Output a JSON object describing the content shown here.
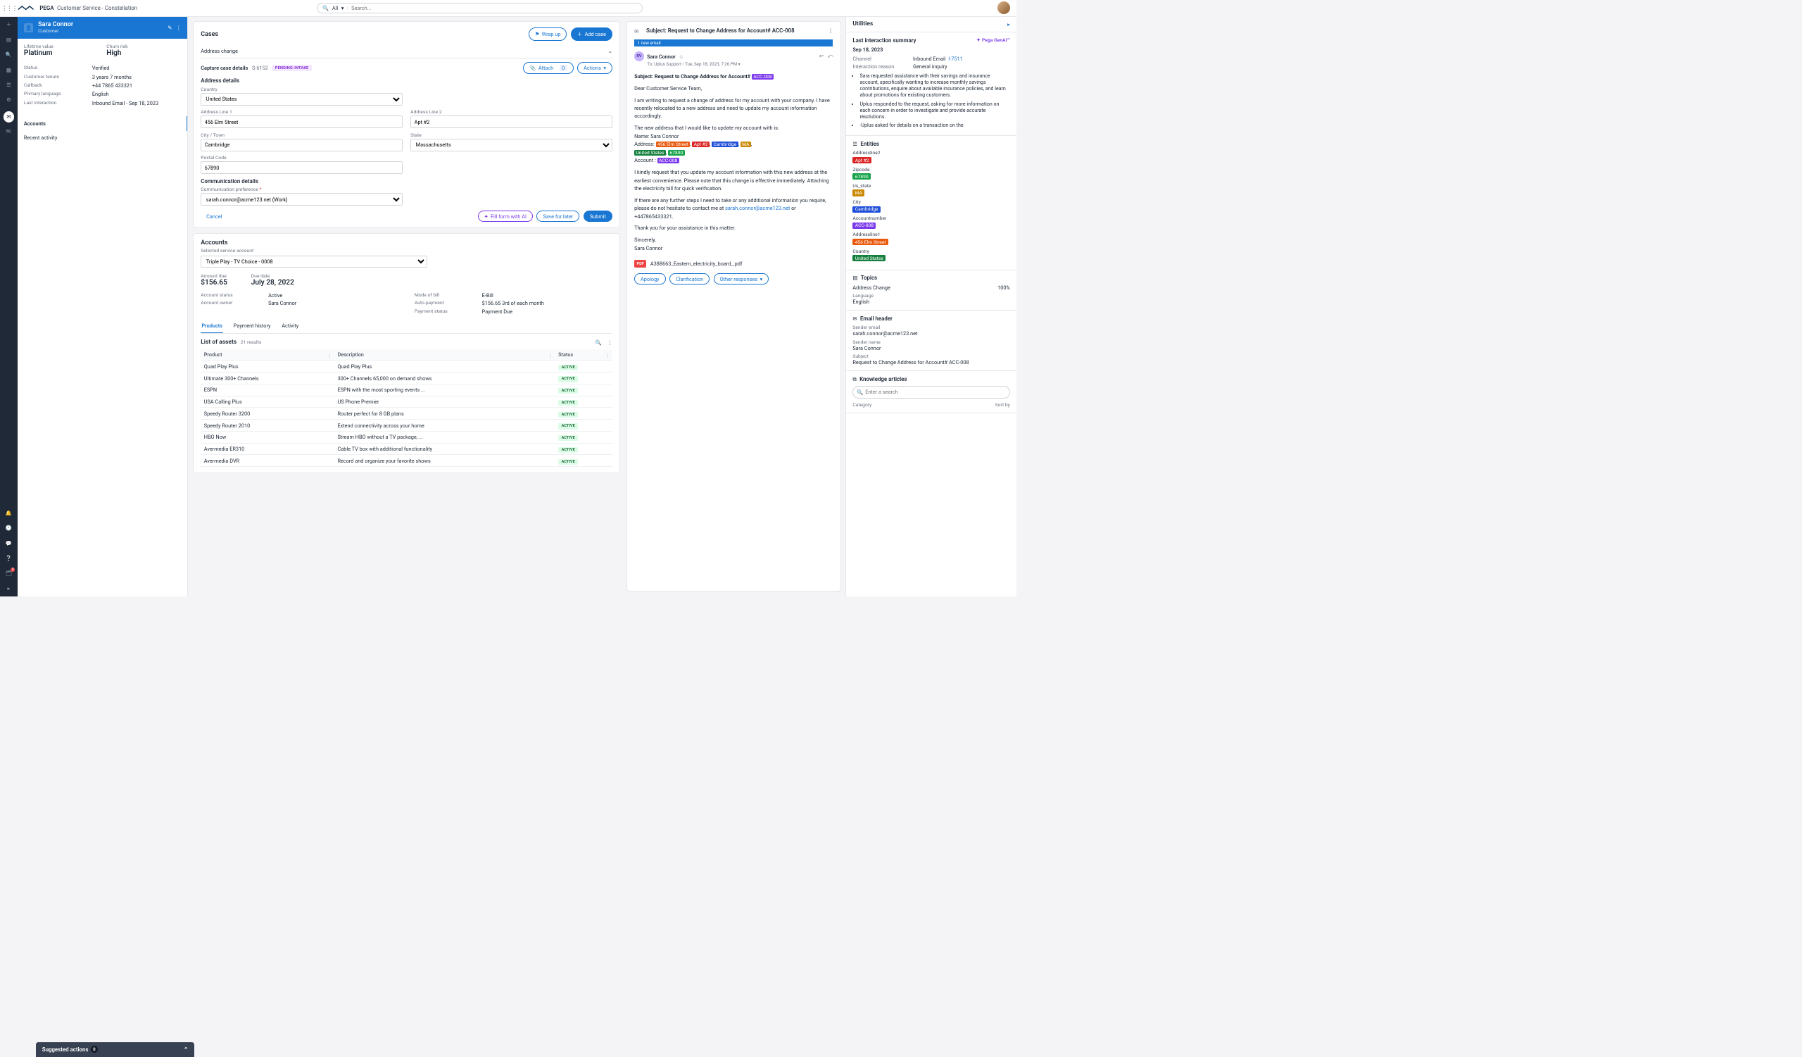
{
  "topbar": {
    "brand": "PEGA",
    "appname": "Customer Service - Constellation",
    "search_filter": "All",
    "search_placeholder": "Search..."
  },
  "customer": {
    "name": "Sara Connor",
    "role": "Customer",
    "lifetime_value_label": "Lifetime value",
    "lifetime_value": "Platinum",
    "churn_label": "Churn risk",
    "churn": "High",
    "rows": {
      "status_label": "Status",
      "status": "Verified",
      "tenure_label": "Customer tenure",
      "tenure": "3 years 7 months",
      "callback_label": "Callback",
      "callback": "+44 7865 433321",
      "lang_label": "Primary language",
      "lang": "English",
      "last_label": "Last interaction",
      "last": "Inbound Email - Sep 18, 2023"
    },
    "nav": {
      "accounts": "Accounts",
      "recent": "Recent activity"
    }
  },
  "cases": {
    "title": "Cases",
    "wrapup": "Wrap up",
    "addcase": "Add case",
    "collapse_label": "Address change",
    "capture_label": "Capture case details",
    "case_id": "S-6152",
    "status": "PENDING-INTAKE",
    "attach_label": "Attach",
    "attach_count": "0",
    "actions_label": "Actions",
    "address_h": "Address details",
    "fields": {
      "country_label": "Country",
      "country": "United States",
      "addr1_label": "Address Line 1",
      "addr1": "456 Elm Street",
      "addr2_label": "Address Line 2",
      "addr2": "Apt #2",
      "city_label": "City / Town",
      "city": "Cambridge",
      "state_label": "State",
      "state": "Massachusetts",
      "postal_label": "Postal Code",
      "postal": "67890"
    },
    "comm_h": "Communication details",
    "comm_pref_label": "Communication preference",
    "comm_pref": "sarah.connor@acme123.net (Work)",
    "cancel": "Cancel",
    "fill_ai": "Fill form with AI",
    "save_later": "Save for later",
    "submit": "Submit"
  },
  "accounts": {
    "title": "Accounts",
    "selected_label": "Selected service account",
    "selected": "Triple Play - TV Choice - 0008",
    "amount_due_label": "Amount due",
    "amount_due": "$156.65",
    "due_date_label": "Due date",
    "due_date": "July 28, 2022",
    "acct_status_label": "Account status",
    "acct_status": "Active",
    "mode_label": "Mode of bill",
    "mode": "E-Bill",
    "owner_label": "Account owner",
    "owner": "Sara Connor",
    "autopay_label": "Auto-payment",
    "autopay": "$156.65 3rd of each month",
    "paystat_label": "Payment status",
    "paystat": "Payment Due",
    "tabs": {
      "products": "Products",
      "payhist": "Payment history",
      "activity": "Activity"
    },
    "list_title": "List of assets",
    "list_count": "21 results",
    "cols": {
      "product": "Product",
      "desc": "Description",
      "status": "Status"
    },
    "rows": [
      {
        "p": "Quad Play Plus",
        "d": "Quad Play Plus",
        "s": "ACTIVE"
      },
      {
        "p": "Ultimate 300+ Channels",
        "d": "300+ Channels 65,000 on demand shows",
        "s": "ACTIVE"
      },
      {
        "p": "ESPN",
        "d": "ESPN with the most sporting events ...",
        "s": "ACTIVE"
      },
      {
        "p": "USA Calling Plus",
        "d": "US Phone Premier",
        "s": "ACTIVE"
      },
      {
        "p": "Speedy Router 3200",
        "d": "Router perfect for 8 GB plans",
        "s": "ACTIVE"
      },
      {
        "p": "Speedy Router 2010",
        "d": "Extend connectivity across your home",
        "s": "ACTIVE"
      },
      {
        "p": "HBO Now",
        "d": "Stream HBO without a TV package, ...",
        "s": "ACTIVE"
      },
      {
        "p": "Avermedia ER310",
        "d": "Cable TV box with additional functionality",
        "s": "ACTIVE"
      },
      {
        "p": "Avermedia DVR",
        "d": "Record and organize your favorite shows",
        "s": "ACTIVE"
      }
    ]
  },
  "email": {
    "subject_h": "Subject: Request to Change Address for Account# ACC-008",
    "newmail": "1 new email",
    "from_initials": "RV",
    "from_name": "Sara Connor",
    "to_line": "To: Uplus Support • Tue, Sep 18, 2023, 7:26 PM",
    "subject_inline": "Subject: Request to Change Address for Account# ",
    "acc_tag": "ACC-008",
    "greeting": "Dear Customer Service Team,",
    "p1": "I am writing to request a change of address for my account with your company. I have recently relocated to a new address and need to update my account information accordingly.",
    "p2_intro": "The new address that I would like to update my account with is:",
    "p2_name": "Name: Sara Connor",
    "p2_addr_label": "Address:",
    "addr1": "456 Elm Street",
    "addr2": "Apt #2",
    "city": "Cambridge",
    "state": "MA",
    "country": "United States",
    "zip": "67890",
    "acc_label": "Account :",
    "acc": "ACC-008",
    "p3": "I kindly request that you update my account information with this new address at the earliest convenience. Please note that this change is effective immediately. Attaching the electricity bill for quick verification.",
    "p4_a": "If there are any further steps I need to take or any additional information you require, please do not hesitate to contact me at ",
    "email_link": "sarah.connor@acme123.net",
    "p4_b": " or +447865433321.",
    "thanks": "Thank you for your assistance in this matter.",
    "signoff": "Sincerely,",
    "sig": "Sara Connor",
    "attach_name": "A388663_Eastern_electricity_board_.pdf",
    "actions": {
      "apology": "Apology",
      "clarification": "Clarification",
      "other": "Other responses"
    }
  },
  "utils": {
    "title": "Utilities",
    "summary": {
      "title": "Last interaction summary",
      "genai": "Pega GenAI™",
      "date": "Sep 18, 2023",
      "channel_label": "Channel",
      "channel": "Inbound Email",
      "channel_link": "I-7511",
      "reason_label": "Interaction reason",
      "reason": "General inquiry",
      "bullets": [
        "Sara requested assistance with their savings and insurance account, specifically wanting to increase monthly savings contributions, enquire about available insurance policies, and learn about promotions for existing customers.",
        "Uplus responded to the request, asking for more information on each concern in order to investigate and provide accurate resolutions.",
        "-Uplus asked for details on a transaction on the"
      ]
    },
    "entities": {
      "title": "Entities",
      "items": [
        {
          "label": "Addressline2",
          "value": "Apt #2",
          "color": "#dc2626"
        },
        {
          "label": "Zipcode",
          "value": "67890",
          "color": "#16a34a"
        },
        {
          "label": "Us_state",
          "value": "MA",
          "color": "#ca8a04"
        },
        {
          "label": "City",
          "value": "Cambridge",
          "color": "#1d4ed8"
        },
        {
          "label": "Accountnumber",
          "value": "ACC-008",
          "color": "#7c3aed"
        },
        {
          "label": "Addressline1",
          "value": "456 Elm Street",
          "color": "#ea580c"
        },
        {
          "label": "Country",
          "value": "United States",
          "color": "#15803d"
        }
      ]
    },
    "topics": {
      "title": "Topics",
      "rows": [
        {
          "name": "Address Change",
          "pct": "100%"
        }
      ],
      "lang_label": "Language",
      "lang": "English"
    },
    "emailheader": {
      "title": "Email header",
      "sender_email_label": "Sender email",
      "sender_email": "sarah.connor@acme123.net",
      "sender_name_label": "Sender name",
      "sender_name": "Sara Connor",
      "subject_label": "Subject",
      "subject": "Request to Change Address for Account# ACC-008"
    },
    "ka": {
      "title": "Knowledge articles",
      "placeholder": "Enter a search",
      "cat_label": "Category",
      "sort_label": "Sort by"
    }
  },
  "suggested": {
    "label": "Suggested actions",
    "count": "0"
  }
}
